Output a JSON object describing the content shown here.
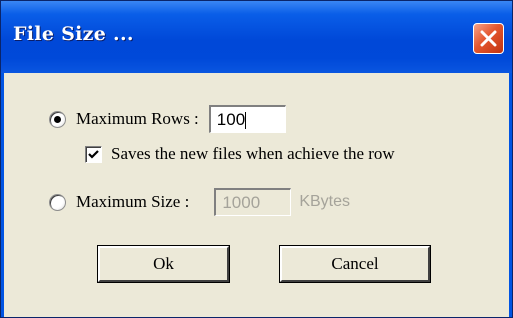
{
  "window": {
    "title": "File Size ..."
  },
  "options": {
    "max_rows_label": "Maximum Rows :",
    "max_rows_value": "100",
    "max_rows_selected": true,
    "save_new_files_label": "Saves the new files when achieve the row",
    "save_new_files_checked": true,
    "max_size_label": "Maximum Size :",
    "max_size_value": "1000",
    "max_size_unit": "KBytes",
    "max_size_selected": false
  },
  "buttons": {
    "ok_label": "Ok",
    "cancel_label": "Cancel"
  }
}
